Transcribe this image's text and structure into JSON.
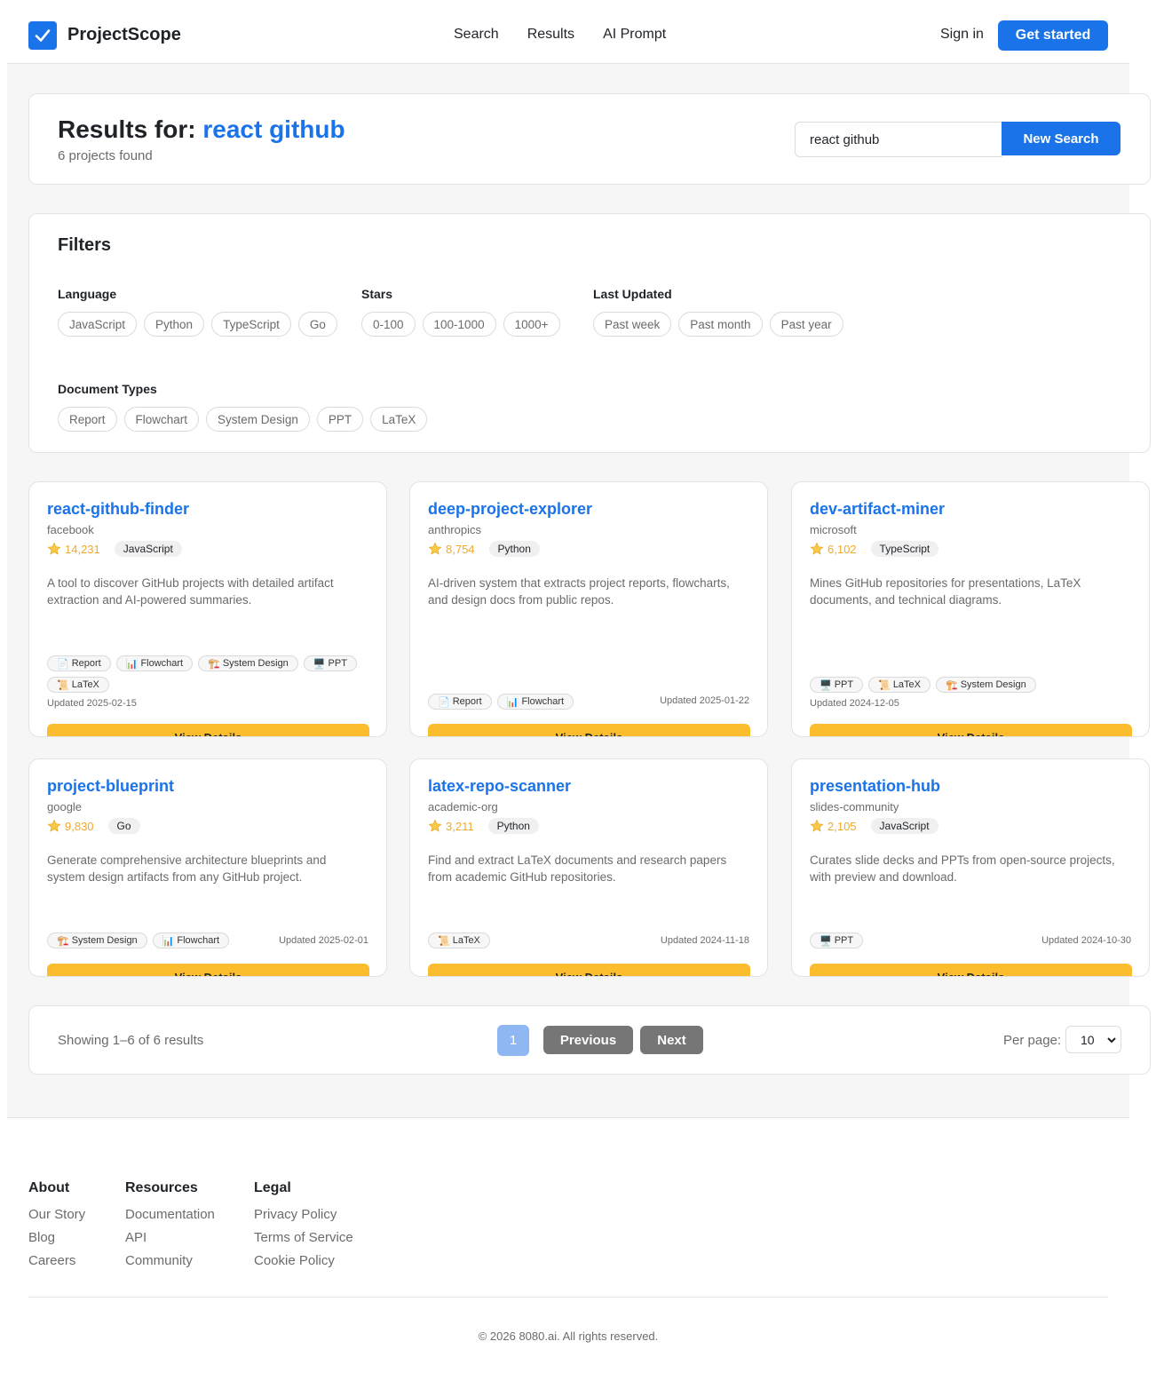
{
  "header": {
    "brand": "ProjectScope",
    "nav": [
      "Search",
      "Results",
      "AI Prompt"
    ],
    "signin": "Sign in",
    "cta": "Get started"
  },
  "results": {
    "prefix": "Results for:",
    "query": "react github",
    "count": "6 projects found",
    "input_value": "react github",
    "button": "New Search"
  },
  "filters": {
    "title": "Filters",
    "language": {
      "label": "Language",
      "options": [
        "JavaScript",
        "Python",
        "TypeScript",
        "Go"
      ]
    },
    "stars": {
      "label": "Stars",
      "options": [
        "0-100",
        "100-1000",
        "1000+"
      ]
    },
    "updated": {
      "label": "Last Updated",
      "options": [
        "Past week",
        "Past month",
        "Past year"
      ]
    },
    "doctypes": {
      "label": "Document Types",
      "options": [
        "Report",
        "Flowchart",
        "System Design",
        "PPT",
        "LaTeX"
      ]
    }
  },
  "cards": [
    {
      "name": "react-github-finder",
      "owner": "facebook",
      "stars": "14,231",
      "lang": "JavaScript",
      "desc": "A tool to discover GitHub projects with detailed artifact extraction and AI-powered summaries.",
      "tags": [
        [
          "📄",
          "Report"
        ],
        [
          "📊",
          "Flowchart"
        ],
        [
          "🏗️",
          "System Design"
        ],
        [
          "🖥️",
          "PPT"
        ],
        [
          "📜",
          "LaTeX"
        ]
      ],
      "updated": "Updated 2025-02-15",
      "button": "View Details"
    },
    {
      "name": "deep-project-explorer",
      "owner": "anthropics",
      "stars": "8,754",
      "lang": "Python",
      "desc": "AI-driven system that extracts project reports, flowcharts, and design docs from public repos.",
      "tags": [
        [
          "📄",
          "Report"
        ],
        [
          "📊",
          "Flowchart"
        ]
      ],
      "updated": "Updated 2025-01-22",
      "button": "View Details"
    },
    {
      "name": "dev-artifact-miner",
      "owner": "microsoft",
      "stars": "6,102",
      "lang": "TypeScript",
      "desc": "Mines GitHub repositories for presentations, LaTeX documents, and technical diagrams.",
      "tags": [
        [
          "🖥️",
          "PPT"
        ],
        [
          "📜",
          "LaTeX"
        ],
        [
          "🏗️",
          "System Design"
        ]
      ],
      "updated": "Updated 2024-12-05",
      "button": "View Details"
    },
    {
      "name": "project-blueprint",
      "owner": "google",
      "stars": "9,830",
      "lang": "Go",
      "desc": "Generate comprehensive architecture blueprints and system design artifacts from any GitHub project.",
      "tags": [
        [
          "🏗️",
          "System Design"
        ],
        [
          "📊",
          "Flowchart"
        ]
      ],
      "updated": "Updated 2025-02-01",
      "button": "View Details"
    },
    {
      "name": "latex-repo-scanner",
      "owner": "academic-org",
      "stars": "3,211",
      "lang": "Python",
      "desc": "Find and extract LaTeX documents and research papers from academic GitHub repositories.",
      "tags": [
        [
          "📜",
          "LaTeX"
        ]
      ],
      "updated": "Updated 2024-11-18",
      "button": "View Details"
    },
    {
      "name": "presentation-hub",
      "owner": "slides-community",
      "stars": "2,105",
      "lang": "JavaScript",
      "desc": "Curates slide decks and PPTs from open-source projects, with preview and download.",
      "tags": [
        [
          "🖥️",
          "PPT"
        ]
      ],
      "updated": "Updated 2024-10-30",
      "button": "View Details"
    }
  ],
  "pagination": {
    "showing": "Showing 1–6 of 6 results",
    "page": "1",
    "previous": "Previous",
    "next": "Next",
    "per_page_label": "Per page:",
    "per_page_value": "10"
  },
  "footer": {
    "about": {
      "title": "About",
      "links": [
        "Our Story",
        "Blog",
        "Careers"
      ]
    },
    "resources": {
      "title": "Resources",
      "links": [
        "Documentation",
        "API",
        "Community"
      ]
    },
    "legal": {
      "title": "Legal",
      "links": [
        "Privacy Policy",
        "Terms of Service",
        "Cookie Policy"
      ]
    },
    "copyright": "© 2026 8080.ai. All rights reserved."
  },
  "colors": {
    "accent": "#1a73e8",
    "button_yellow": "#fbbd2e",
    "star": "#f0a928",
    "background": "#f6f6f6"
  },
  "icons": [
    "check-logo-icon",
    "star-icon",
    "chevron-down-icon"
  ]
}
